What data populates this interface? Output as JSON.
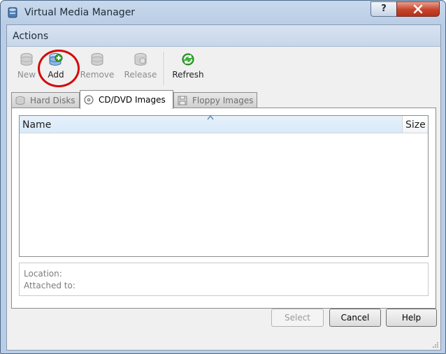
{
  "window": {
    "title": "Virtual Media Manager",
    "help_glyph": "?",
    "close_glyph": "X"
  },
  "actions": {
    "label": "Actions"
  },
  "toolbar": [
    {
      "label": "New",
      "enabled": false,
      "icon": "new-disk-icon"
    },
    {
      "label": "Add",
      "enabled": true,
      "icon": "add-disk-icon"
    },
    {
      "label": "Remove",
      "enabled": false,
      "icon": "remove-disk-icon"
    },
    {
      "label": "Release",
      "enabled": false,
      "icon": "release-disk-icon"
    },
    {
      "label": "Refresh",
      "enabled": true,
      "icon": "refresh-icon"
    }
  ],
  "annotation": {
    "color": "#d20a0a"
  },
  "tabs": [
    {
      "label": "Hard Disks",
      "active": false,
      "icon": "hard-disk-icon"
    },
    {
      "label": "CD/DVD Images",
      "active": true,
      "icon": "cd-dvd-icon"
    },
    {
      "label": "Floppy Images",
      "active": false,
      "icon": "floppy-icon"
    }
  ],
  "list": {
    "columns": [
      "Name",
      "Size"
    ],
    "rows": []
  },
  "info": {
    "location_label": "Location:",
    "attached_label": "Attached to:"
  },
  "buttons": {
    "select": "Select",
    "cancel": "Cancel",
    "help": "Help"
  },
  "colors": {
    "title_bar": "#b9cde6",
    "close_button": "#c6432b",
    "header_highlight": "#d9eaf9"
  }
}
